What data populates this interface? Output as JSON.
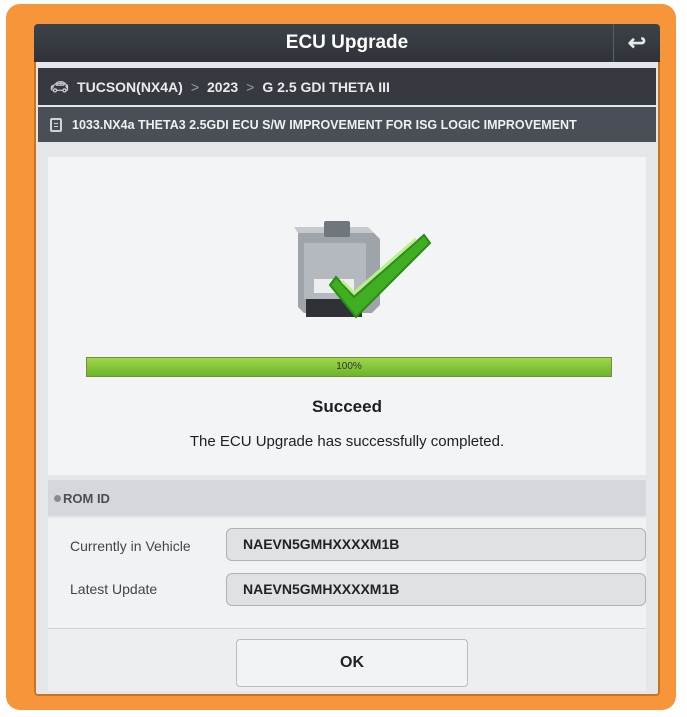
{
  "window": {
    "title": "ECU Upgrade"
  },
  "breadcrumb": {
    "model": "TUCSON(NX4A)",
    "year": "2023",
    "engine": "G 2.5 GDI THETA III",
    "separator": ">"
  },
  "procedure": {
    "title": "1033.NX4a THETA3 2.5GDI ECU S/W IMPROVEMENT FOR ISG LOGIC IMPROVEMENT"
  },
  "progress": {
    "value": 1.0,
    "label": "100%"
  },
  "status": {
    "title": "Succeed",
    "message": "The ECU Upgrade has successfully completed."
  },
  "rom": {
    "header": "ROM ID",
    "current_label": "Currently in Vehicle",
    "current_value": "NAEVN5GMHXXXXM1B",
    "latest_label": "Latest Update",
    "latest_value": "NAEVN5GMHXXXXM1B"
  },
  "actions": {
    "ok_label": "OK"
  },
  "icons": {
    "back": "return-arrow-icon",
    "car": "car-icon",
    "document": "document-icon",
    "success": "ecu-checkmark-icon"
  },
  "colors": {
    "accent_frame": "#f6953a",
    "progress": "#7cc438",
    "check": "#3fae22"
  }
}
